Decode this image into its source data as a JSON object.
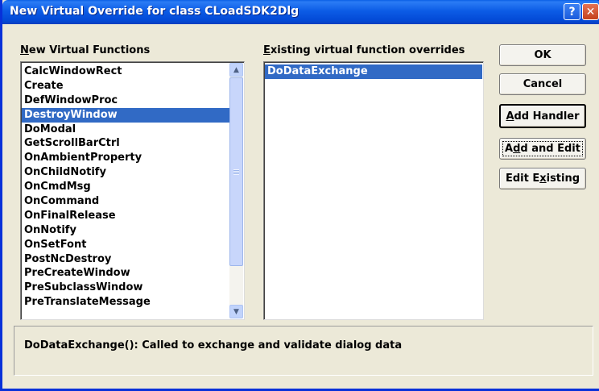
{
  "window": {
    "title": "New Virtual Override for class CLoadSDK2Dlg",
    "help_glyph": "?",
    "close_glyph": "✕"
  },
  "left_panel": {
    "label_accel": "N",
    "label_rest": "ew Virtual Functions",
    "items": [
      "CalcWindowRect",
      "Create",
      "DefWindowProc",
      "DestroyWindow",
      "DoModal",
      "GetScrollBarCtrl",
      "OnAmbientProperty",
      "OnChildNotify",
      "OnCmdMsg",
      "OnCommand",
      "OnFinalRelease",
      "OnNotify",
      "OnSetFont",
      "PostNcDestroy",
      "PreCreateWindow",
      "PreSubclassWindow",
      "PreTranslateMessage"
    ],
    "selected": "DestroyWindow"
  },
  "right_panel": {
    "label_accel": "E",
    "label_rest": "xisting virtual function overrides",
    "items": [
      "DoDataExchange"
    ],
    "selected": "DoDataExchange"
  },
  "buttons": {
    "ok": "OK",
    "cancel": "Cancel",
    "add_handler_accel": "A",
    "add_handler_rest": "dd Handler",
    "add_edit_pre": "A",
    "add_edit_accel": "d",
    "add_edit_rest": "d and Edit",
    "edit_existing_pre": "Edit E",
    "edit_existing_accel": "x",
    "edit_existing_rest": "isting"
  },
  "description": {
    "text": "DoDataExchange(): Called to exchange and validate dialog data"
  },
  "icons": {
    "scroll_up": "chevron-up-icon",
    "scroll_down": "chevron-down-icon",
    "help": "help-icon",
    "close": "close-icon"
  },
  "colors": {
    "titlebar": "#0c5ce6",
    "selection": "#316ac5",
    "dialog_bg": "#ece9d8"
  }
}
